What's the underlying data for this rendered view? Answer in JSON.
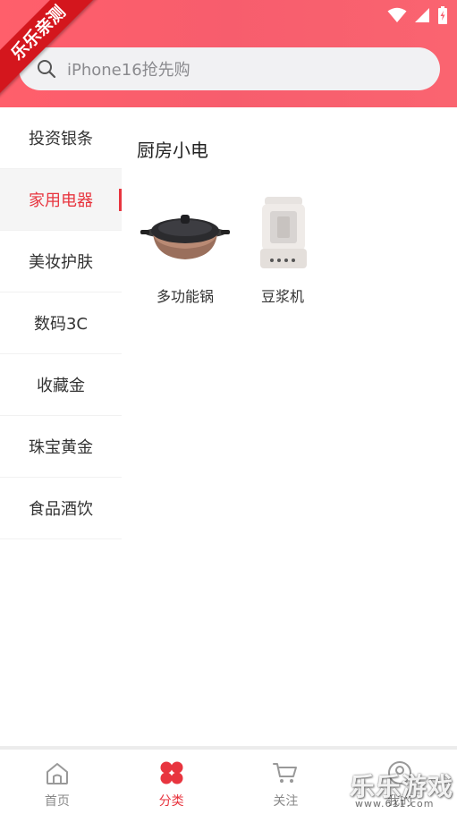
{
  "header": {
    "search": {
      "placeholder": "iPhone16抢先购"
    },
    "ribbon": "乐乐亲测"
  },
  "sidebar": {
    "items": [
      {
        "label": "投资银条",
        "active": false
      },
      {
        "label": "家用电器",
        "active": true
      },
      {
        "label": "美妆护肤",
        "active": false
      },
      {
        "label": "数码3C",
        "active": false
      },
      {
        "label": "收藏金",
        "active": false
      },
      {
        "label": "珠宝黄金",
        "active": false
      },
      {
        "label": "食品酒饮",
        "active": false
      }
    ]
  },
  "main": {
    "section_title": "厨房小电",
    "products": [
      {
        "name": "多功能锅",
        "icon": "electric-pot-image"
      },
      {
        "name": "豆浆机",
        "icon": "soymilk-maker-image"
      }
    ]
  },
  "bottom_nav": {
    "items": [
      {
        "label": "首页",
        "icon": "home-icon",
        "active": false
      },
      {
        "label": "分类",
        "icon": "category-icon",
        "active": true
      },
      {
        "label": "关注",
        "icon": "cart-icon",
        "active": false
      },
      {
        "label": "我的",
        "icon": "profile-icon",
        "active": false
      }
    ]
  },
  "watermark": {
    "text": "乐乐游戏",
    "sub": "www.611.com"
  },
  "colors": {
    "accent": "#e8353f",
    "header_start": "#ff5f6b",
    "header_end": "#fa6470"
  }
}
